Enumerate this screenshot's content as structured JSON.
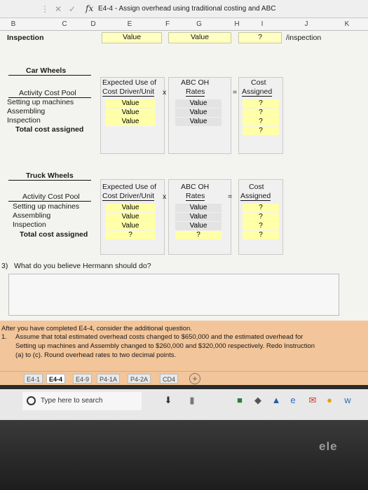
{
  "formula_bar": {
    "fx": "fx",
    "text": "E4-4 - Assign overhead using traditional costing and ABC"
  },
  "columns": [
    "B",
    "C",
    "D",
    "E",
    "F",
    "G",
    "H",
    "I",
    "J",
    "K"
  ],
  "top_row": {
    "b": "Inspection",
    "e": "Value",
    "g": "Value",
    "i": "?",
    "j": "/inspection"
  },
  "car": {
    "title": "Car Wheels",
    "pool_header": "Activity Cost Pool",
    "rows": [
      "Setting up machines",
      "Assembling",
      "Inspection"
    ],
    "total": "Total cost assigned",
    "use_header_1": "Expected Use of",
    "use_header_2": "Cost Driver/Unit",
    "times": "x",
    "rate_header_1": "ABC OH",
    "rate_header_2": "Rates",
    "equals": "=",
    "cost_header_1": "Cost",
    "cost_header_2": "Assigned",
    "use_values": [
      "Value",
      "Value",
      "Value"
    ],
    "rate_values": [
      "Value",
      "Value",
      "Value"
    ],
    "cost_values": [
      "?",
      "?",
      "?"
    ],
    "cost_total": "?"
  },
  "truck": {
    "title": "Truck Wheels",
    "pool_header": "Activity Cost Pool",
    "rows": [
      "Setting up machines",
      "Assembling",
      "Inspection"
    ],
    "total": "Total cost assigned",
    "use_header_1": "Expected Use of",
    "use_header_2": "Cost Driver/Unit",
    "times": "x",
    "rate_header_1": "ABC OH",
    "rate_header_2": "Rates",
    "equals": "=",
    "cost_header_1": "Cost",
    "cost_header_2": "Assigned",
    "use_values": [
      "Value",
      "Value",
      "Value"
    ],
    "use_total": "?",
    "rate_values": [
      "Value",
      "Value",
      "Value"
    ],
    "rate_total": "?",
    "cost_values": [
      "?",
      "?",
      "?"
    ],
    "cost_total": "?"
  },
  "question": {
    "marker": "3)",
    "text": "What do you believe Hermann should do?"
  },
  "additional": {
    "line1": "After you have completed E4-4, consider the additional question.",
    "num": "1.",
    "line2": "Assume that total estimated overhead costs changed to $650,000 and the estimated overhead for",
    "line3": "Setting up machines and Assembly changed to $260,000 and $320,000 respectively. Redo Instruction",
    "line4": "(a) to (c). Round overhead rates to two decimal points."
  },
  "tabs": [
    "E4-1",
    "E4-4",
    "E4-9",
    "P4-1A",
    "P4-2A",
    "CD4"
  ],
  "active_tab": "E4-4",
  "taskbar": {
    "search_placeholder": "Type here to search"
  },
  "logo": "ele"
}
